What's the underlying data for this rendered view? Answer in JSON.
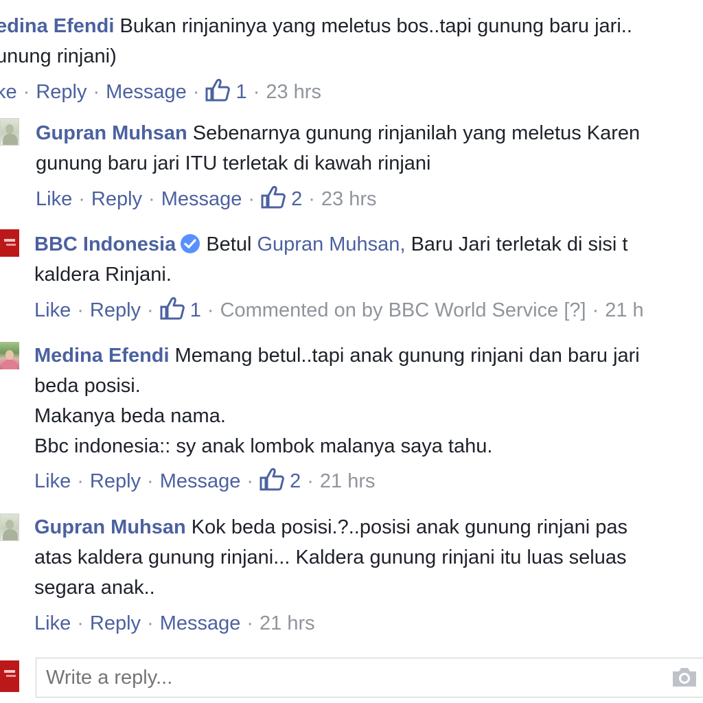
{
  "comments": [
    {
      "author": "edina Efendi",
      "line1": "Bukan rinjaninya yang meletus bos..tapi gunung baru jari..",
      "line2": "unung rinjani)",
      "actions": {
        "like": "ke",
        "reply": "Reply",
        "message": "Message",
        "likes": "1",
        "time": "23 hrs"
      }
    },
    {
      "author": "Gupran Muhsan",
      "line1": "Sebenarnya gunung rinjanilah yang meletus Karen",
      "line2": "gunung baru jari ITU terletak di kawah rinjani",
      "actions": {
        "like": "Like",
        "reply": "Reply",
        "message": "Message",
        "likes": "2",
        "time": "23 hrs"
      }
    },
    {
      "author": "BBC Indonesia",
      "line1_prefix": "Betul",
      "line1_mention": "Gupran Muhsan,",
      "line1_rest": "Baru Jari terletak di sisi t",
      "line2": "kaldera Rinjani.",
      "actions": {
        "like": "Like",
        "reply": "Reply",
        "likes": "1",
        "commented_on": "Commented on by BBC World Service",
        "help": "[?]",
        "time": "21 h"
      }
    },
    {
      "author": "Medina Efendi",
      "line1": "Memang betul..tapi anak gunung rinjani dan baru jari",
      "line2": "beda posisi.",
      "line3": "Makanya beda nama.",
      "line4": "Bbc indonesia:: sy anak lombok malanya saya tahu.",
      "actions": {
        "like": "Like",
        "reply": "Reply",
        "message": "Message",
        "likes": "2",
        "time": "21 hrs"
      }
    },
    {
      "author": "Gupran Muhsan",
      "line1": "Kok beda posisi.?..posisi anak gunung rinjani pas",
      "line2": "atas kaldera gunung rinjani... Kaldera gunung rinjani itu luas seluas",
      "line3": "segara anak..",
      "actions": {
        "like": "Like",
        "reply": "Reply",
        "message": "Message",
        "time": "21 hrs"
      }
    }
  ],
  "reply_box": {
    "placeholder": "Write a reply..."
  },
  "icons": {
    "like": "thumbs-up-icon",
    "verified": "verified-badge-icon",
    "camera": "camera-icon"
  },
  "colors": {
    "link": "#4b61a0",
    "meta": "#90949c",
    "text": "#1d2129",
    "verified": "#5890ff",
    "bbc": "#bb1919"
  }
}
